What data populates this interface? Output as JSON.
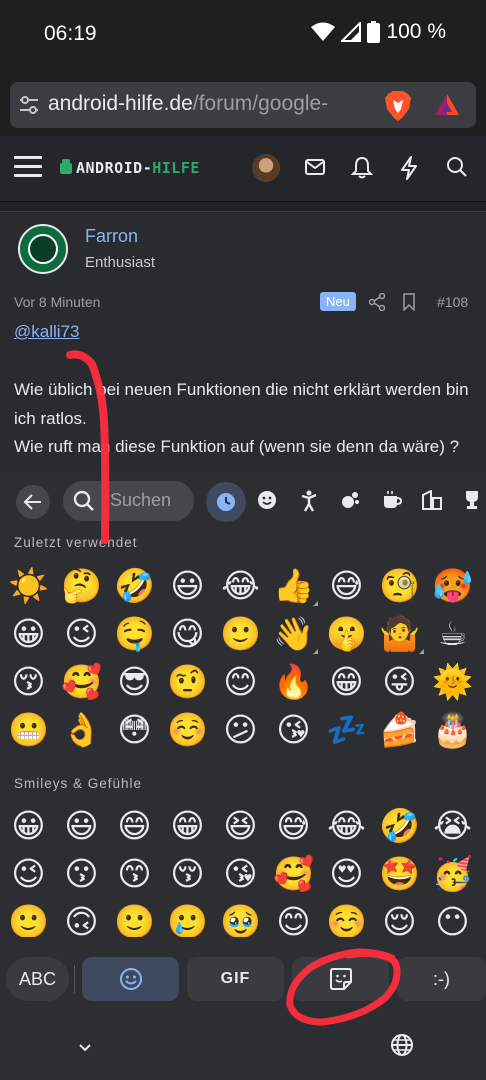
{
  "status_bar": {
    "time": "06:19",
    "battery": "100 %",
    "icons": [
      "wifi-icon",
      "signal-icon",
      "battery-icon"
    ]
  },
  "browser": {
    "url_host": "android-hilfe.de",
    "url_path": "/forum/google-",
    "icons": [
      "tune-icon",
      "brave-lion-icon",
      "brave-rewards-icon"
    ]
  },
  "site_header": {
    "logo_part1": "ANDROID-",
    "logo_part2": "HILFE",
    "icons": [
      "menu-icon",
      "avatar",
      "mail-icon",
      "bell-icon",
      "bolt-icon",
      "search-icon"
    ]
  },
  "post": {
    "author_name": "Farron",
    "author_role": "Enthusiast",
    "time": "Vor 8 Minuten",
    "badge": "Neu",
    "number": "#108",
    "mention": "@kalli73",
    "body": "Wie üblich bei neuen Funktionen die nicht erklärt werden bin ich ratlos.\nWie ruft man diese Funktion auf (wenn sie denn da wäre) ?"
  },
  "emoji_keyboard": {
    "search_placeholder": "Suchen",
    "categories": [
      "recent-icon",
      "smileys-icon",
      "people-icon",
      "animals-icon",
      "food-icon",
      "travel-icon",
      "activities-icon"
    ],
    "recent_label": "Zuletzt verwendet",
    "recent": [
      "☀️",
      "🤔",
      "🤣",
      "😃",
      "😂",
      "👍",
      "😅",
      "🧐",
      "🥵",
      "😀",
      "😉",
      "🤤",
      "😋",
      "🙂",
      "👋",
      "🤫",
      "🤷",
      "☕",
      "😚",
      "🥰",
      "😎",
      "🤨",
      "😊",
      "🔥",
      "😁",
      "😜",
      "🌞",
      "😬",
      "👌",
      "😳",
      "☺️",
      "😕",
      "😘",
      "💤",
      "🍰",
      "🎂"
    ],
    "smileys_label": "Smileys & Gefühle",
    "smileys": [
      "😀",
      "😃",
      "😄",
      "😁",
      "😆",
      "😅",
      "😂",
      "🤣",
      "😭",
      "😉",
      "😗",
      "😙",
      "😚",
      "😘",
      "🥰",
      "😍",
      "🤩",
      "🥳",
      "🙂",
      "🙃",
      "🙂",
      "🥲",
      "🥹",
      "😊",
      "☺️",
      "😌",
      "😶"
    ],
    "tabs": {
      "abc": "ABC",
      "gif": "GIF",
      "emoticon": ":-)"
    }
  },
  "colors": {
    "accent_blue": "#8ab4f8",
    "logo_green": "#2ea86b",
    "annotation_red": "#ff2d3d"
  }
}
